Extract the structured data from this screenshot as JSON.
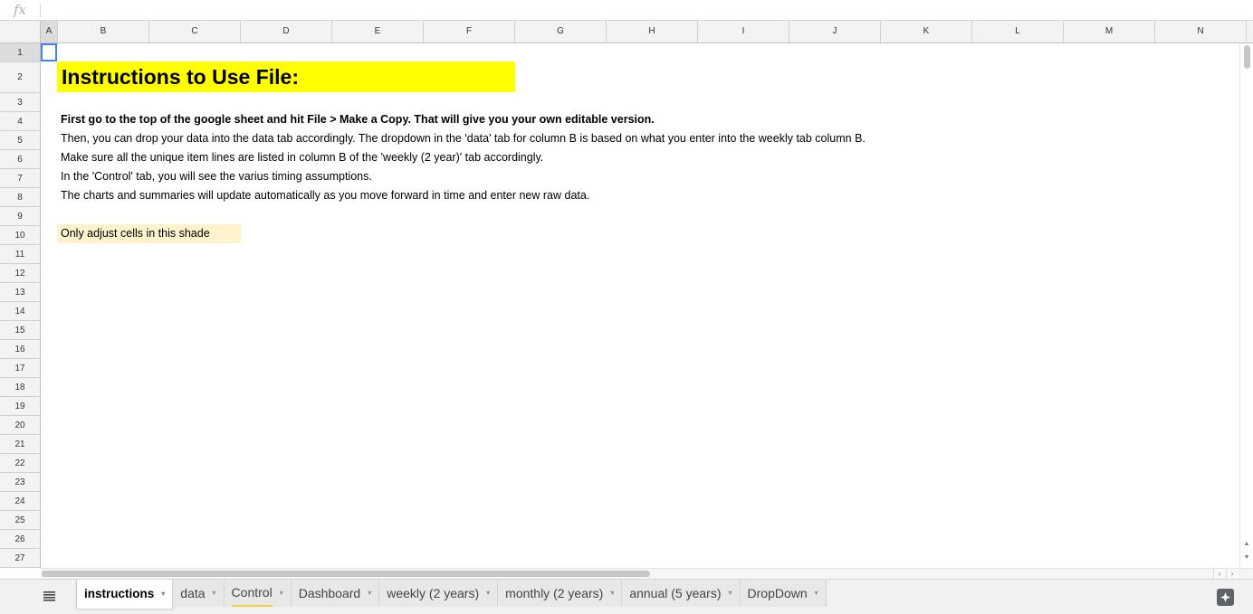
{
  "formula_bar": {
    "fx_label": "fx",
    "value": ""
  },
  "columns": [
    "A",
    "B",
    "C",
    "D",
    "E",
    "F",
    "G",
    "H",
    "I",
    "J",
    "K",
    "L",
    "M",
    "N"
  ],
  "active_column": "A",
  "rows": [
    "1",
    "2",
    "3",
    "4",
    "5",
    "6",
    "7",
    "8",
    "9",
    "10",
    "11",
    "12",
    "13",
    "14",
    "15",
    "16",
    "17",
    "18",
    "19",
    "20",
    "21",
    "22",
    "23",
    "24",
    "25",
    "26",
    "27"
  ],
  "active_row": "1",
  "cells": {
    "title": "Instructions to Use File:",
    "line4": "First go to the top of the google sheet and hit File > Make a Copy. That will give you your own editable version.",
    "line5": "Then, you can drop your data into the data tab accordingly. The dropdown in the 'data' tab for column B is based on what you enter into the weekly tab column B.",
    "line6": "Make sure all the unique item lines are listed in column B of the 'weekly (2 year)' tab accordingly.",
    "line7": "In the 'Control' tab, you will see the varius timing assumptions.",
    "line8": "The charts and summaries will update automatically as you move forward in time and enter new raw data.",
    "line10": "Only adjust cells in this shade"
  },
  "colors": {
    "title_fill": "#ffff00",
    "shade_fill": "#fff2cc",
    "selection": "#4285f4",
    "control_tab_underline": "#f4cd3a"
  },
  "tabs": [
    {
      "label": "instructions",
      "active": true
    },
    {
      "label": "data",
      "active": false
    },
    {
      "label": "Control",
      "active": false,
      "underlined": true
    },
    {
      "label": "Dashboard",
      "active": false
    },
    {
      "label": "weekly (2 years)",
      "active": false
    },
    {
      "label": "monthly (2 years)",
      "active": false
    },
    {
      "label": "annual (5 years)",
      "active": false
    },
    {
      "label": "DropDown",
      "active": false
    }
  ],
  "icons": {
    "sheets_menu": "hamburger-icon",
    "explore": "explore-icon",
    "tab_caret": "▾",
    "scroll_up": "▲",
    "scroll_down": "▼",
    "scroll_left": "‹",
    "scroll_right": "›"
  }
}
